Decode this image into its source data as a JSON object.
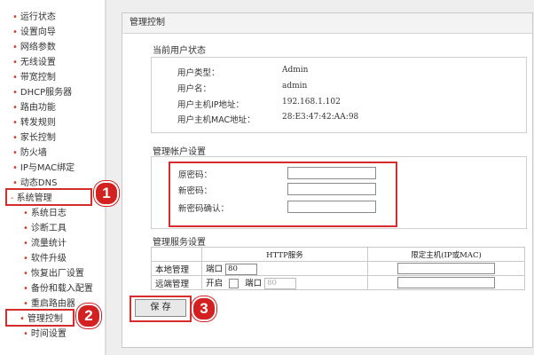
{
  "sidebar": {
    "items": [
      {
        "label": "运行状态"
      },
      {
        "label": "设置向导"
      },
      {
        "label": "网络参数"
      },
      {
        "label": "无线设置"
      },
      {
        "label": "带宽控制"
      },
      {
        "label": "DHCP服务器"
      },
      {
        "label": "路由功能"
      },
      {
        "label": "转发规则"
      },
      {
        "label": "家长控制"
      },
      {
        "label": "防火墙"
      },
      {
        "label": "IP与MAC绑定"
      },
      {
        "label": "动态DNS"
      },
      {
        "label": "系统管理"
      }
    ],
    "sub_items": [
      {
        "label": "系统日志"
      },
      {
        "label": "诊断工具"
      },
      {
        "label": "流量统计"
      },
      {
        "label": "软件升级"
      },
      {
        "label": "恢复出厂设置"
      },
      {
        "label": "备份和载入配置"
      },
      {
        "label": "重启路由器"
      },
      {
        "label": "管理控制"
      },
      {
        "label": "时间设置"
      }
    ]
  },
  "panel": {
    "title": "管理控制"
  },
  "user_status": {
    "title": "当前用户状态",
    "rows": [
      {
        "label": "用户类型：",
        "value": "Admin"
      },
      {
        "label": "用户名：",
        "value": "admin"
      },
      {
        "label": "用户主机IP地址：",
        "value": "192.168.1.102"
      },
      {
        "label": "用户主机MAC地址：",
        "value": "28:E3:47:42:AA:98"
      }
    ]
  },
  "account": {
    "title": "管理帐户设置",
    "fields": [
      {
        "label": "原密码："
      },
      {
        "label": "新密码："
      },
      {
        "label": "新密码确认："
      }
    ]
  },
  "service": {
    "title": "管理服务设置",
    "headers": [
      "HTTP服务",
      "限定主机(IP或MAC)"
    ],
    "rows": [
      {
        "label": "本地管理",
        "port_label": "端口",
        "port": "80"
      },
      {
        "label": "远端管理",
        "enable_label": "开启",
        "port_label": "端口",
        "port": "80"
      }
    ]
  },
  "save_label": "保 存",
  "steps": [
    "1",
    "2",
    "3"
  ],
  "colors": {
    "highlight": "#d62c2c",
    "badge": "#d32020",
    "bullet": "#c9412a"
  }
}
